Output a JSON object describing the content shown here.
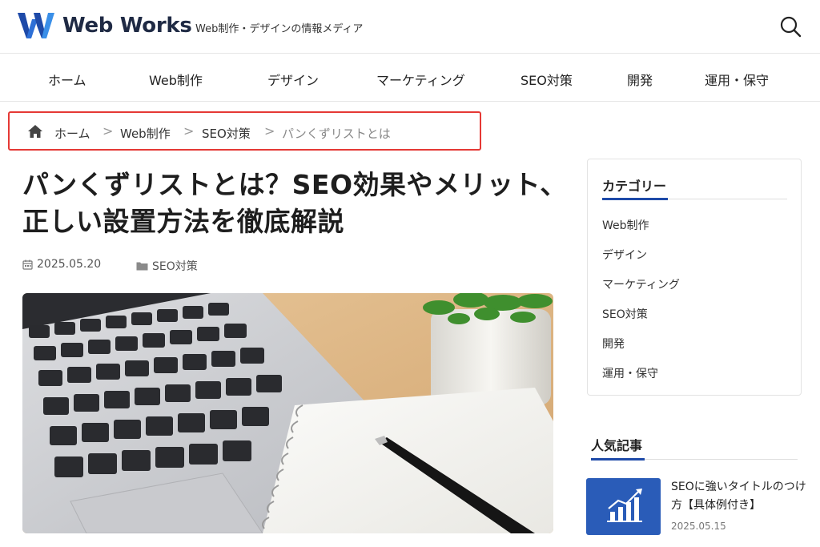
{
  "header": {
    "logo_text": "Web Works",
    "tagline": "Web制作・デザインの情報メディア"
  },
  "nav": {
    "items": [
      "ホーム",
      "Web制作",
      "デザイン",
      "マーケティング",
      "SEO対策",
      "開発",
      "運用・保守"
    ]
  },
  "breadcrumb": {
    "items": [
      "ホーム",
      "Web制作",
      "SEO対策",
      "パンくずリストとは"
    ],
    "separator": ">"
  },
  "article": {
    "title_line1": "パンくずリストとは？SEO効果やメリット、",
    "title_line2": "正しい設置方法を徹底解説",
    "date": "2025.05.20",
    "category": "SEO対策"
  },
  "sidebar": {
    "categories_heading": "カテゴリー",
    "categories": [
      "Web制作",
      "デザイン",
      "マーケティング",
      "SEO対策",
      "開発",
      "運用・保守"
    ],
    "popular_heading": "人気記事",
    "popular": [
      {
        "title": "SEOに強いタイトルのつけ方【具体例付き】",
        "date": "2025.05.15"
      }
    ]
  },
  "colors": {
    "brand_dark": "#1f2a44",
    "accent_blue": "#1e4aa8",
    "breadcrumb_highlight": "#e53935"
  },
  "icons": [
    "logo-w-icon",
    "search-icon",
    "home-icon",
    "calendar-icon",
    "folder-icon",
    "chart-up-icon"
  ]
}
